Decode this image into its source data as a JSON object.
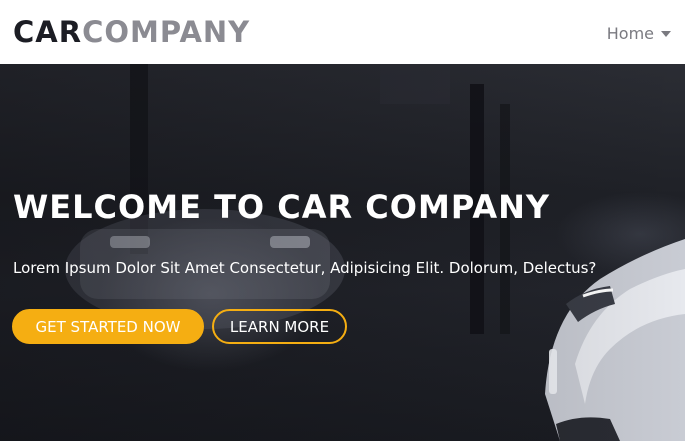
{
  "navbar": {
    "logo_part1": "CAR",
    "logo_part2": "COMPANY",
    "home_label": "Home"
  },
  "hero": {
    "title": "WELCOME TO CAR COMPANY",
    "subtitle": "Lorem Ipsum Dolor Sit Amet Consectetur, Adipisicing Elit. Dolorum, Delectus?",
    "primary_button": "GET STARTED NOW",
    "secondary_button": "LEARN MORE"
  },
  "colors": {
    "accent": "#f5ae12",
    "logo_dark": "#1c1d24",
    "logo_grey": "#8b8b92",
    "nav_text": "#7a7a80"
  },
  "icons": {
    "dropdown": "caret-down-icon"
  }
}
